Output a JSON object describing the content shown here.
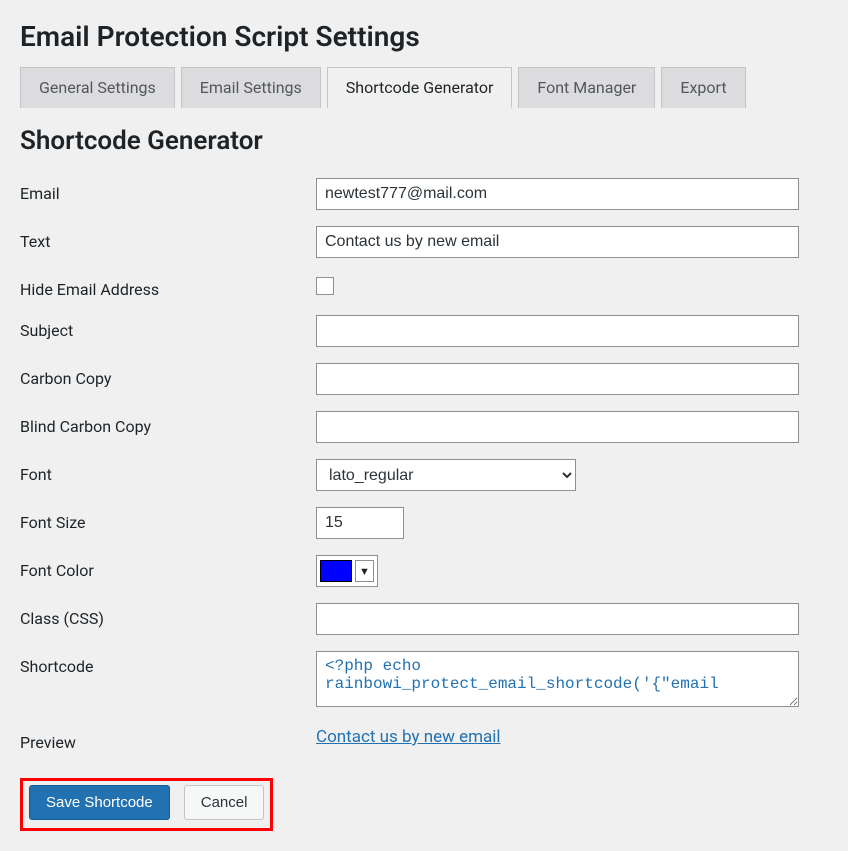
{
  "page_title": "Email Protection Script Settings",
  "tabs": [
    {
      "label": "General Settings",
      "active": false
    },
    {
      "label": "Email Settings",
      "active": false
    },
    {
      "label": "Shortcode Generator",
      "active": true
    },
    {
      "label": "Font Manager",
      "active": false
    },
    {
      "label": "Export",
      "active": false
    }
  ],
  "section_title": "Shortcode Generator",
  "fields": {
    "email": {
      "label": "Email",
      "value": "newtest777@mail.com"
    },
    "text": {
      "label": "Text",
      "value": "Contact us by new email"
    },
    "hide_email": {
      "label": "Hide Email Address",
      "checked": false
    },
    "subject": {
      "label": "Subject",
      "value": ""
    },
    "cc": {
      "label": "Carbon Copy",
      "value": ""
    },
    "bcc": {
      "label": "Blind Carbon Copy",
      "value": ""
    },
    "font": {
      "label": "Font",
      "value": "lato_regular"
    },
    "font_size": {
      "label": "Font Size",
      "value": "15"
    },
    "font_color": {
      "label": "Font Color",
      "value": "#0000ff"
    },
    "class": {
      "label": "Class (CSS)",
      "value": ""
    },
    "shortcode": {
      "label": "Shortcode",
      "value": "<?php echo rainbowi_protect_email_shortcode('{\"email"
    },
    "preview": {
      "label": "Preview",
      "link_text": "Contact us by new email"
    }
  },
  "buttons": {
    "save": "Save Shortcode",
    "cancel": "Cancel"
  }
}
